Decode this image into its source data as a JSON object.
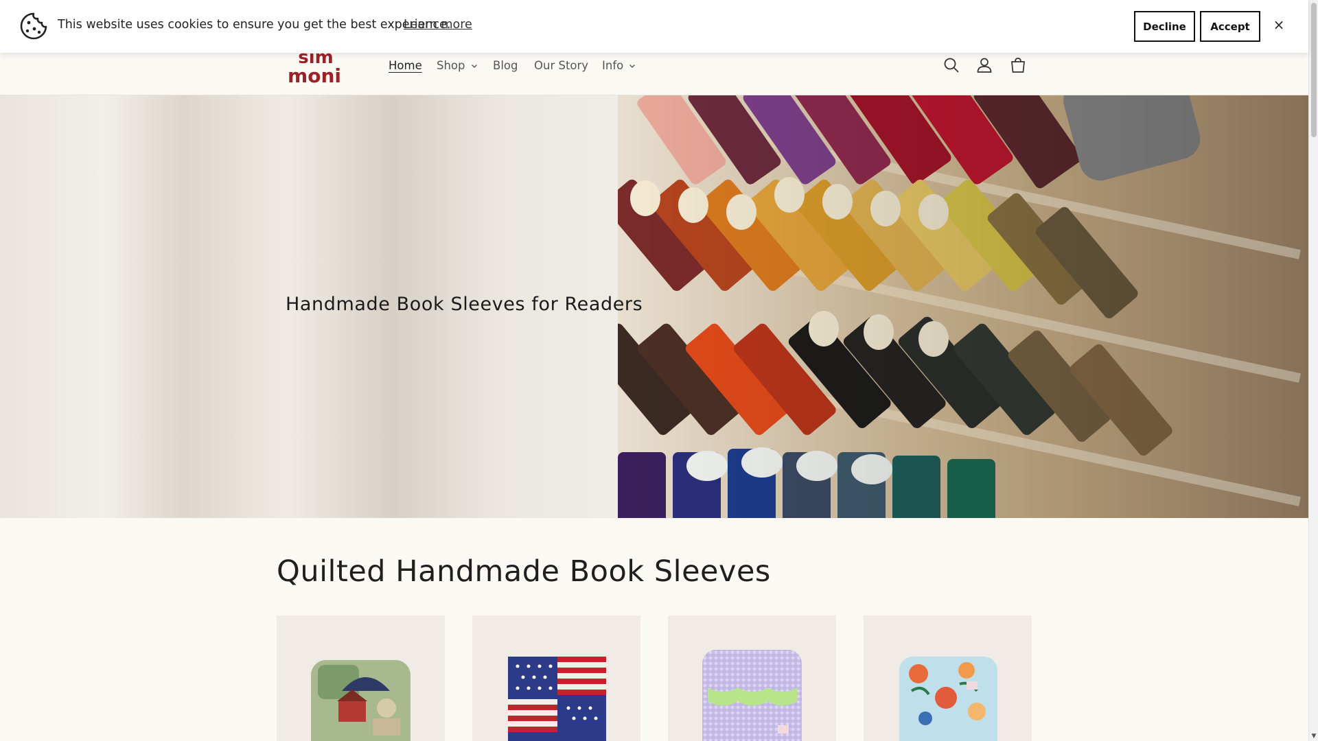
{
  "cookie_banner": {
    "message": "This website uses cookies to ensure you get the best experience.",
    "learn_more": "Learn more",
    "decline_label": "Decline",
    "accept_label": "Accept",
    "close_label": "×"
  },
  "header": {
    "logo_text_top": "sim",
    "logo_text_bottom": "moni",
    "nav": [
      {
        "label": "Home",
        "active": true,
        "dropdown": false
      },
      {
        "label": "Shop",
        "active": false,
        "dropdown": true
      },
      {
        "label": "Blog",
        "active": false,
        "dropdown": false
      },
      {
        "label": "Our Story",
        "active": false,
        "dropdown": false
      },
      {
        "label": "Info",
        "active": false,
        "dropdown": true
      }
    ],
    "icons": [
      "search-icon",
      "account-icon",
      "cart-icon"
    ]
  },
  "hero": {
    "title": "Handmade Book Sleeves for Readers"
  },
  "collection": {
    "title": "Quilted Handmade Book Sleeves",
    "products": [
      {
        "name": "patchwork-village-sleeve"
      },
      {
        "name": "stars-and-stripes-sleeve"
      },
      {
        "name": "lilac-gingham-sleeve"
      },
      {
        "name": "floral-birds-sleeve"
      }
    ]
  },
  "colors": {
    "brand_red": "#9b2226",
    "page_bg": "#fbf9f4",
    "text_dark": "#1f1f1f"
  }
}
